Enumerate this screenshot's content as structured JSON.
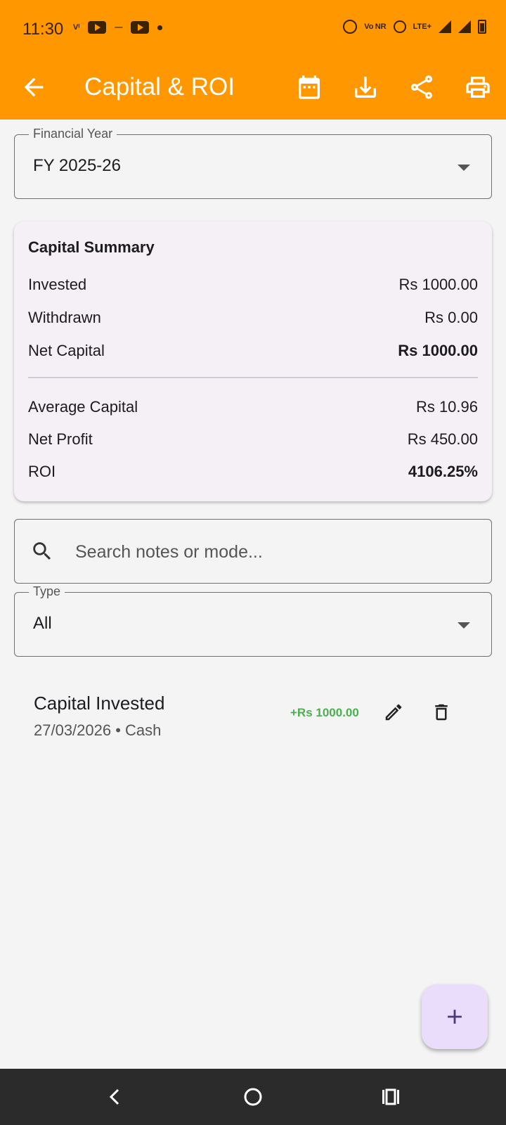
{
  "status_bar": {
    "time": "11:30",
    "carrier_mark": "Vᴵ",
    "volte_label": "Vo NR",
    "lte_label": "LTE+"
  },
  "app_bar": {
    "title": "Capital & ROI",
    "back_icon": "arrow-left-icon",
    "actions": [
      "calendar-icon",
      "download-icon",
      "share-icon",
      "print-icon"
    ],
    "background": "#ff9800"
  },
  "financial_year": {
    "label": "Financial Year",
    "value": "FY 2025-26"
  },
  "summary": {
    "title": "Capital Summary",
    "invested_label": "Invested",
    "invested_value": "Rs 1000.00",
    "withdrawn_label": "Withdrawn",
    "withdrawn_value": "Rs 0.00",
    "net_capital_label": "Net Capital",
    "net_capital_value": "Rs 1000.00",
    "average_capital_label": "Average Capital",
    "average_capital_value": "Rs 10.96",
    "net_profit_label": "Net Profit",
    "net_profit_value": "Rs 450.00",
    "roi_label": "ROI",
    "roi_value": "4106.25%"
  },
  "search": {
    "placeholder": "Search notes or mode..."
  },
  "type_filter": {
    "label": "Type",
    "value": "All"
  },
  "entries": [
    {
      "title": "Capital Invested",
      "subtitle": "27/03/2026 • Cash",
      "amount": "+Rs 1000.00",
      "amount_color": "#4caf50"
    }
  ],
  "fab": {
    "icon": "plus-icon",
    "background": "#eaddfb"
  },
  "nav_bar": {
    "buttons": [
      "back-nav-icon",
      "home-nav-icon",
      "recents-nav-icon"
    ]
  }
}
